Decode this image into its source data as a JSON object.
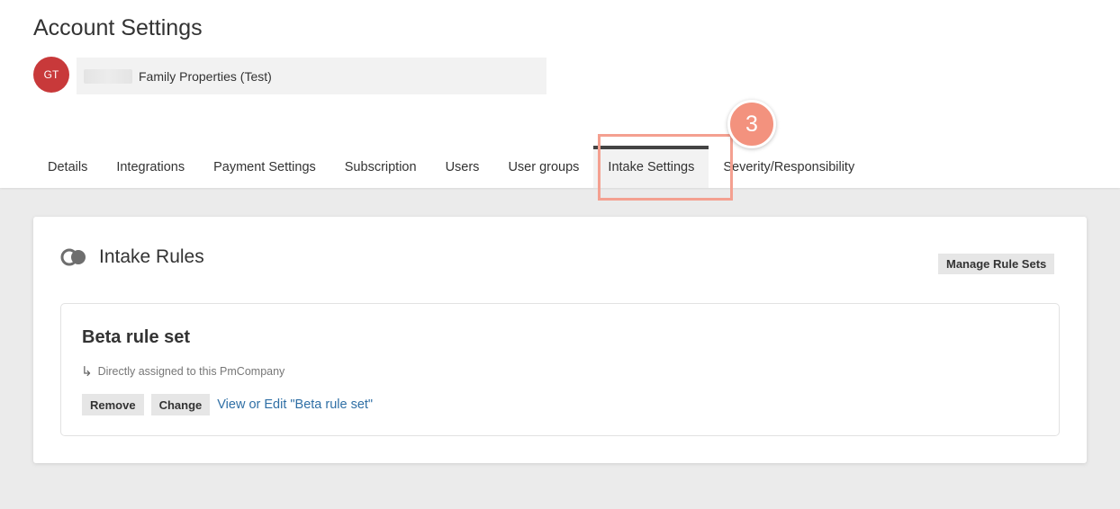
{
  "header": {
    "title": "Account Settings",
    "avatar_initials": "GT",
    "company_name": "Family Properties (Test)"
  },
  "tabs": [
    {
      "label": "Details",
      "active": false
    },
    {
      "label": "Integrations",
      "active": false
    },
    {
      "label": "Payment Settings",
      "active": false
    },
    {
      "label": "Subscription",
      "active": false
    },
    {
      "label": "Users",
      "active": false
    },
    {
      "label": "User groups",
      "active": false
    },
    {
      "label": "Intake Settings",
      "active": true
    },
    {
      "label": "Severity/Responsibility",
      "active": false
    }
  ],
  "annotation": {
    "step_number": "3",
    "highlight_color": "#f4a090",
    "badge_color": "#f3927e"
  },
  "intake": {
    "title": "Intake Rules",
    "icon": "overlapping-circles-icon",
    "manage_label": "Manage Rule Sets",
    "ruleset": {
      "name": "Beta rule set",
      "assignment_icon": "arrow-return-right-icon",
      "assignment_text": "Directly assigned to this PmCompany",
      "remove_label": "Remove",
      "change_label": "Change",
      "view_edit_label": "View or Edit \"Beta rule set\""
    }
  },
  "colors": {
    "avatar_bg": "#c8393a",
    "link": "#2f6fa5",
    "page_bg": "#ebebeb"
  }
}
